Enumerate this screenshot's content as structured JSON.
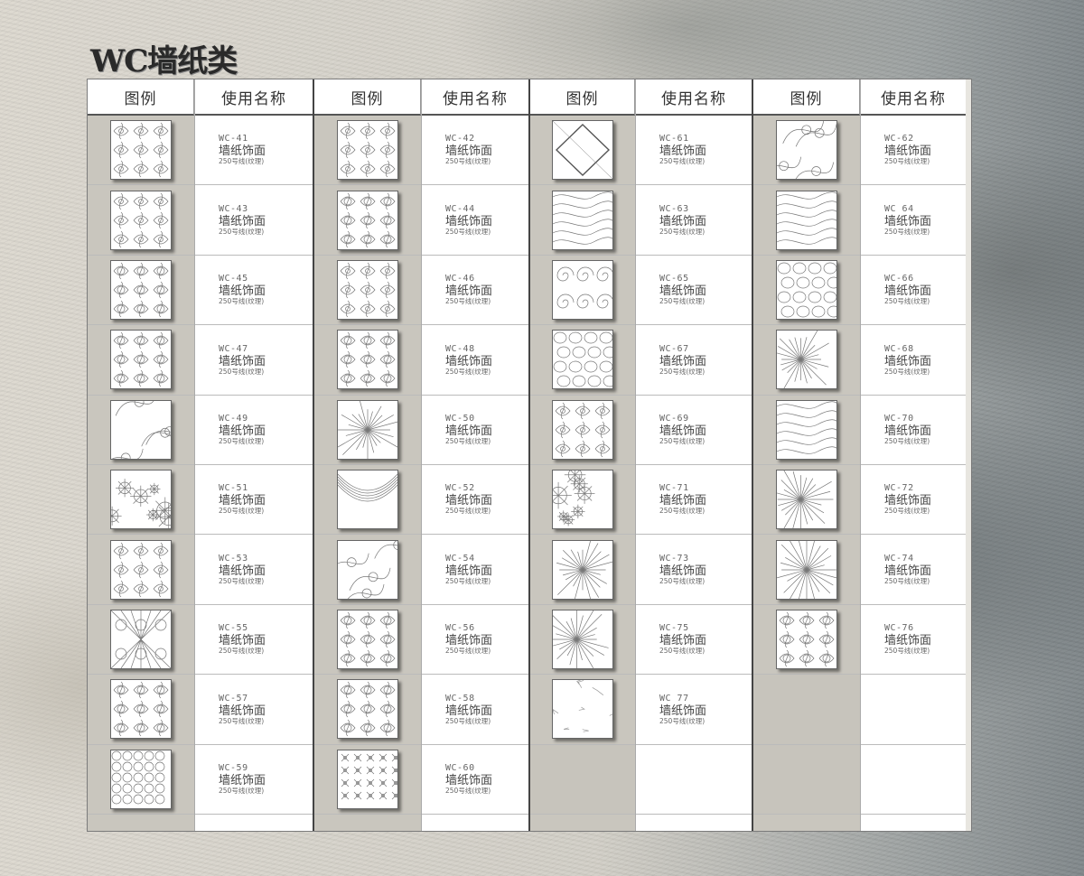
{
  "title": "WC墙纸类",
  "headers": {
    "image": "图例",
    "name": "使用名称"
  },
  "groups": [
    {
      "items": [
        {
          "code": "WC-41",
          "label": "墙纸饰面",
          "desc": "250号线(纹理)",
          "pattern": "damask"
        },
        {
          "code": "WC-43",
          "label": "墙纸饰面",
          "desc": "250号线(纹理)",
          "pattern": "damask"
        },
        {
          "code": "WC-45",
          "label": "墙纸饰面",
          "desc": "250号线(纹理)",
          "pattern": "floral"
        },
        {
          "code": "WC-47",
          "label": "墙纸饰面",
          "desc": "250号线(纹理)",
          "pattern": "floral"
        },
        {
          "code": "WC-49",
          "label": "墙纸饰面",
          "desc": "250号线(纹理)",
          "pattern": "swirl"
        },
        {
          "code": "WC-51",
          "label": "墙纸饰面",
          "desc": "250号线(纹理)",
          "pattern": "flowers"
        },
        {
          "code": "WC-53",
          "label": "墙纸饰面",
          "desc": "250号线(纹理)",
          "pattern": "damask"
        },
        {
          "code": "WC-55",
          "label": "墙纸饰面",
          "desc": "250号线(纹理)",
          "pattern": "lattice"
        },
        {
          "code": "WC-57",
          "label": "墙纸饰面",
          "desc": "250号线(纹理)",
          "pattern": "floral"
        },
        {
          "code": "WC-59",
          "label": "墙纸饰面",
          "desc": "250号线(纹理)",
          "pattern": "circles"
        }
      ]
    },
    {
      "items": [
        {
          "code": "WC-42",
          "label": "墙纸饰面",
          "desc": "250号线(纹理)",
          "pattern": "damask"
        },
        {
          "code": "WC-44",
          "label": "墙纸饰面",
          "desc": "250号线(纹理)",
          "pattern": "floral"
        },
        {
          "code": "WC-46",
          "label": "墙纸饰面",
          "desc": "250号线(纹理)",
          "pattern": "damask"
        },
        {
          "code": "WC-48",
          "label": "墙纸饰面",
          "desc": "250号线(纹理)",
          "pattern": "floral"
        },
        {
          "code": "WC-50",
          "label": "墙纸饰面",
          "desc": "250号线(纹理)",
          "pattern": "star"
        },
        {
          "code": "WC-52",
          "label": "墙纸饰面",
          "desc": "250号线(纹理)",
          "pattern": "arcs"
        },
        {
          "code": "WC-54",
          "label": "墙纸饰面",
          "desc": "250号线(纹理)",
          "pattern": "swirl"
        },
        {
          "code": "WC-56",
          "label": "墙纸饰面",
          "desc": "250号线(纹理)",
          "pattern": "floral"
        },
        {
          "code": "WC-58",
          "label": "墙纸饰面",
          "desc": "250号线(纹理)",
          "pattern": "floral"
        },
        {
          "code": "WC-60",
          "label": "墙纸饰面",
          "desc": "250号线(纹理)",
          "pattern": "crosses"
        }
      ]
    },
    {
      "items": [
        {
          "code": "WC-61",
          "label": "墙纸饰面",
          "desc": "250号线(纹理)",
          "pattern": "diamond"
        },
        {
          "code": "WC-63",
          "label": "墙纸饰面",
          "desc": "250号线(纹理)",
          "pattern": "waves"
        },
        {
          "code": "WC-65",
          "label": "墙纸饰面",
          "desc": "250号线(纹理)",
          "pattern": "spirals"
        },
        {
          "code": "WC-67",
          "label": "墙纸饰面",
          "desc": "250号线(纹理)",
          "pattern": "cells"
        },
        {
          "code": "WC-69",
          "label": "墙纸饰面",
          "desc": "250号线(纹理)",
          "pattern": "damask"
        },
        {
          "code": "WC-71",
          "label": "墙纸饰面",
          "desc": "250号线(纹理)",
          "pattern": "bursts"
        },
        {
          "code": "WC-73",
          "label": "墙纸饰面",
          "desc": "250号线(纹理)",
          "pattern": "star"
        },
        {
          "code": "WC-75",
          "label": "墙纸饰面",
          "desc": "250号线(纹理)",
          "pattern": "rays"
        },
        {
          "code": "WC 77",
          "label": "墙纸饰面",
          "desc": "250号线(纹理)",
          "pattern": "cracks"
        },
        null
      ]
    },
    {
      "items": [
        {
          "code": "WC-62",
          "label": "墙纸饰面",
          "desc": "250号线(纹理)",
          "pattern": "swirl"
        },
        {
          "code": "WC 64",
          "label": "墙纸饰面",
          "desc": "250号线(纹理)",
          "pattern": "waves"
        },
        {
          "code": "WC-66",
          "label": "墙纸饰面",
          "desc": "250号线(纹理)",
          "pattern": "cells"
        },
        {
          "code": "WC-68",
          "label": "墙纸饰面",
          "desc": "250号线(纹理)",
          "pattern": "rays"
        },
        {
          "code": "WC-70",
          "label": "墙纸饰面",
          "desc": "250号线(纹理)",
          "pattern": "waves"
        },
        {
          "code": "WC-72",
          "label": "墙纸饰面",
          "desc": "250号线(纹理)",
          "pattern": "rays"
        },
        {
          "code": "WC-74",
          "label": "墙纸饰面",
          "desc": "250号线(纹理)",
          "pattern": "star"
        },
        {
          "code": "WC-76",
          "label": "墙纸饰面",
          "desc": "250号线(纹理)",
          "pattern": "floral"
        },
        null,
        null
      ]
    }
  ]
}
